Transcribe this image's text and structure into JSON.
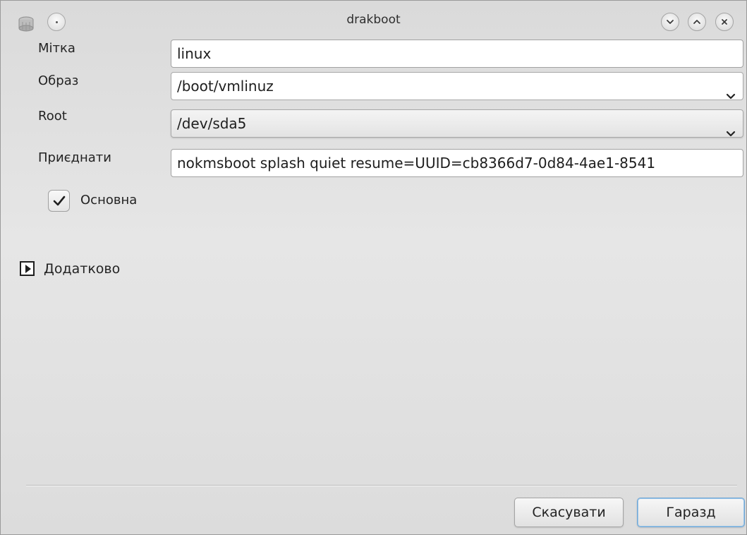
{
  "window": {
    "title": "drakboot"
  },
  "form": {
    "label_label": "Мітка",
    "label_value": "linux",
    "image_label": "Образ",
    "image_value": "/boot/vmlinuz",
    "root_label": "Root",
    "root_value": "/dev/sda5",
    "append_label": "Приєднати",
    "append_value": "nokmsboot splash quiet resume=UUID=cb8366d7-0d84-4ae1-8541",
    "default_label": "Основна",
    "default_checked": true
  },
  "advanced": {
    "label": "Додатково",
    "expanded": false
  },
  "buttons": {
    "cancel": "Скасувати",
    "ok": "Гаразд"
  },
  "icons": {
    "app": "drive-icon",
    "menu": "window-menu-icon",
    "minimize": "minimize-icon",
    "maximize": "maximize-icon",
    "close": "close-icon",
    "dropdown": "chevron-down-icon",
    "check": "checkmark-icon",
    "expander": "triangle-right-icon"
  },
  "colors": {
    "background": "#dcdcdc",
    "field": "#ffffff",
    "default_button_border": "#6fa6d4"
  }
}
